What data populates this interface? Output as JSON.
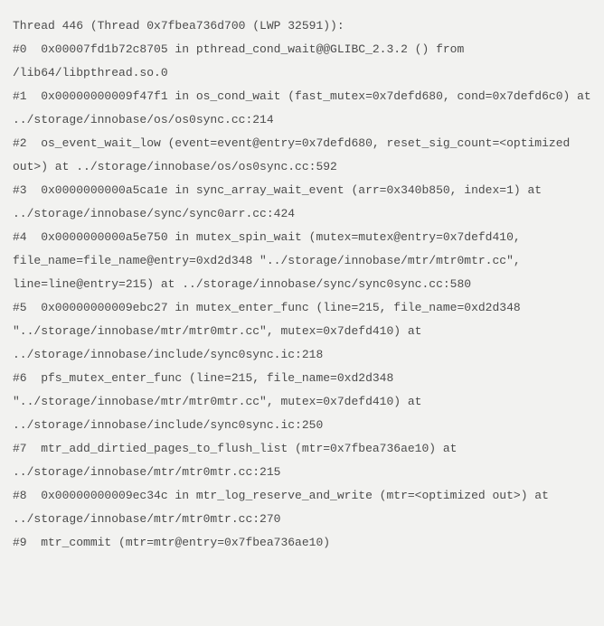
{
  "thread_header": "Thread 446 (Thread 0x7fbea736d700 (LWP 32591)):",
  "frames": [
    "#0  0x00007fd1b72c8705 in pthread_cond_wait@@GLIBC_2.3.2 () from /lib64/libpthread.so.0",
    "#1  0x00000000009f47f1 in os_cond_wait (fast_mutex=0x7defd680, cond=0x7defd6c0) at ../storage/innobase/os/os0sync.cc:214",
    "#2  os_event_wait_low (event=event@entry=0x7defd680, reset_sig_count=<optimized out>) at ../storage/innobase/os/os0sync.cc:592",
    "#3  0x0000000000a5ca1e in sync_array_wait_event (arr=0x340b850, index=1) at ../storage/innobase/sync/sync0arr.cc:424",
    "#4  0x0000000000a5e750 in mutex_spin_wait (mutex=mutex@entry=0x7defd410, file_name=file_name@entry=0xd2d348 \"../storage/innobase/mtr/mtr0mtr.cc\", line=line@entry=215) at ../storage/innobase/sync/sync0sync.cc:580",
    "#5  0x00000000009ebc27 in mutex_enter_func (line=215, file_name=0xd2d348 \"../storage/innobase/mtr/mtr0mtr.cc\", mutex=0x7defd410) at ../storage/innobase/include/sync0sync.ic:218",
    "#6  pfs_mutex_enter_func (line=215, file_name=0xd2d348 \"../storage/innobase/mtr/mtr0mtr.cc\", mutex=0x7defd410) at ../storage/innobase/include/sync0sync.ic:250",
    "#7  mtr_add_dirtied_pages_to_flush_list (mtr=0x7fbea736ae10) at ../storage/innobase/mtr/mtr0mtr.cc:215",
    "#8  0x00000000009ec34c in mtr_log_reserve_and_write (mtr=<optimized out>) at ../storage/innobase/mtr/mtr0mtr.cc:270",
    "#9  mtr_commit (mtr=mtr@entry=0x7fbea736ae10)"
  ]
}
